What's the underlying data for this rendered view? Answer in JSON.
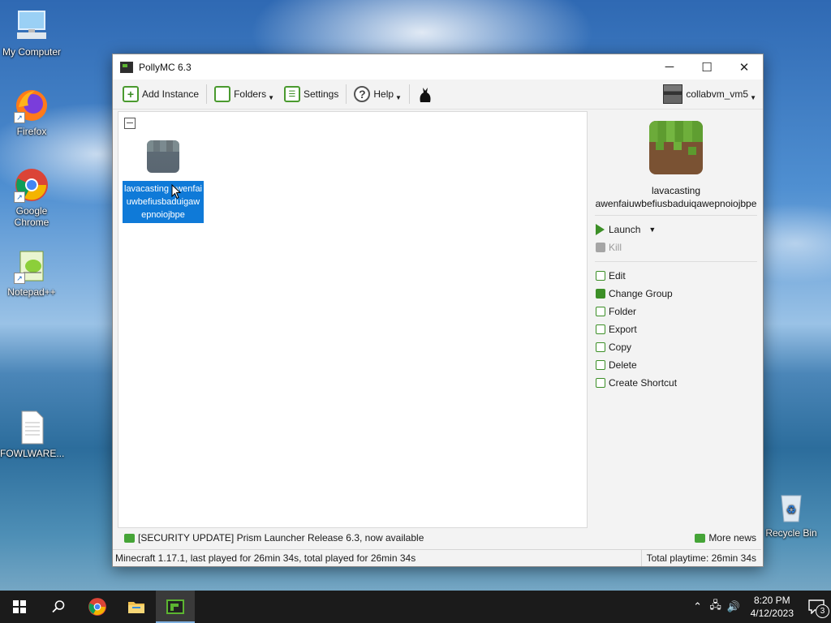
{
  "desktop": {
    "icons": [
      {
        "label": "My Computer"
      },
      {
        "label": "Firefox"
      },
      {
        "label": "Google Chrome"
      },
      {
        "label": "Notepad++"
      },
      {
        "label": "FOWLWARE..."
      },
      {
        "label": "Recycle Bin"
      }
    ]
  },
  "window": {
    "title": "PollyMC 6.3",
    "controls": {
      "minimize": "─",
      "maximize": "☐",
      "close": "✕"
    }
  },
  "toolbar": {
    "add_instance": "Add Instance",
    "folders": "Folders",
    "settings": "Settings",
    "help": "Help",
    "account": "collabvm_vm5"
  },
  "instance": {
    "name": "lavacasting awenfaiuwbefiusbaduigawepnoiojbpe",
    "sidebar_name": "lavacasting awenfaiuwbefiusbaduiqawepnoiojbpe"
  },
  "actions": {
    "launch": "Launch",
    "kill": "Kill",
    "edit": "Edit",
    "change_group": "Change Group",
    "folder": "Folder",
    "export": "Export",
    "copy": "Copy",
    "delete": "Delete",
    "create_shortcut": "Create Shortcut"
  },
  "news": {
    "headline": "[SECURITY UPDATE] Prism Launcher Release 6.3, now available",
    "more_news": "More news"
  },
  "status": {
    "left": "Minecraft 1.17.1, last played for 26min 34s, total played for 26min 34s",
    "right": "Total playtime: 26min 34s"
  },
  "taskbar": {
    "time": "8:20 PM",
    "date": "4/12/2023",
    "notifications": "3"
  },
  "colors": {
    "accent_green": "#4a9a2f",
    "selection_blue": "#0f7ad8"
  }
}
